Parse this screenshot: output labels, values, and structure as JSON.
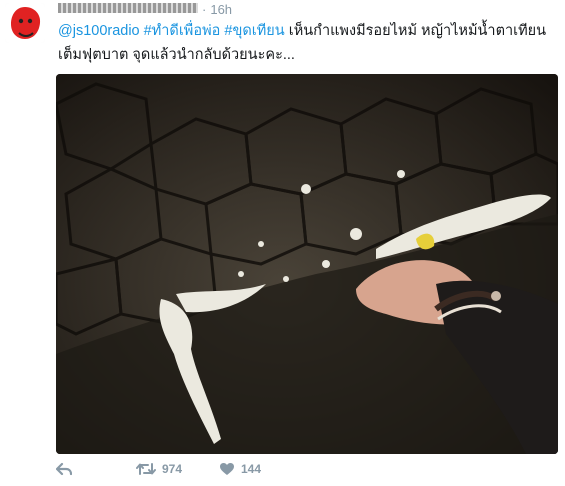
{
  "tweet": {
    "time": "16h",
    "text_links": [
      "@js100radio",
      "#ทำดีเพื่อพ่อ",
      "#ขุดเทียน"
    ],
    "text_body": "เห็นกำแพงมีรอยไหม้ หญ้าไหม้น้ำตาเทียนเต็มฟุตบาต จุดแล้วนำกลับด้วยนะคะ..."
  },
  "media": {
    "image": "photo-candle-wax-on-pavement-hand"
  },
  "actions": {
    "reply_icon": "reply-icon",
    "retweet_icon": "retweet-icon",
    "retweet_count": "974",
    "like_icon": "heart-icon",
    "like_count": "144"
  },
  "colors": {
    "link": "#1b95e0",
    "muted": "#8899a6"
  }
}
